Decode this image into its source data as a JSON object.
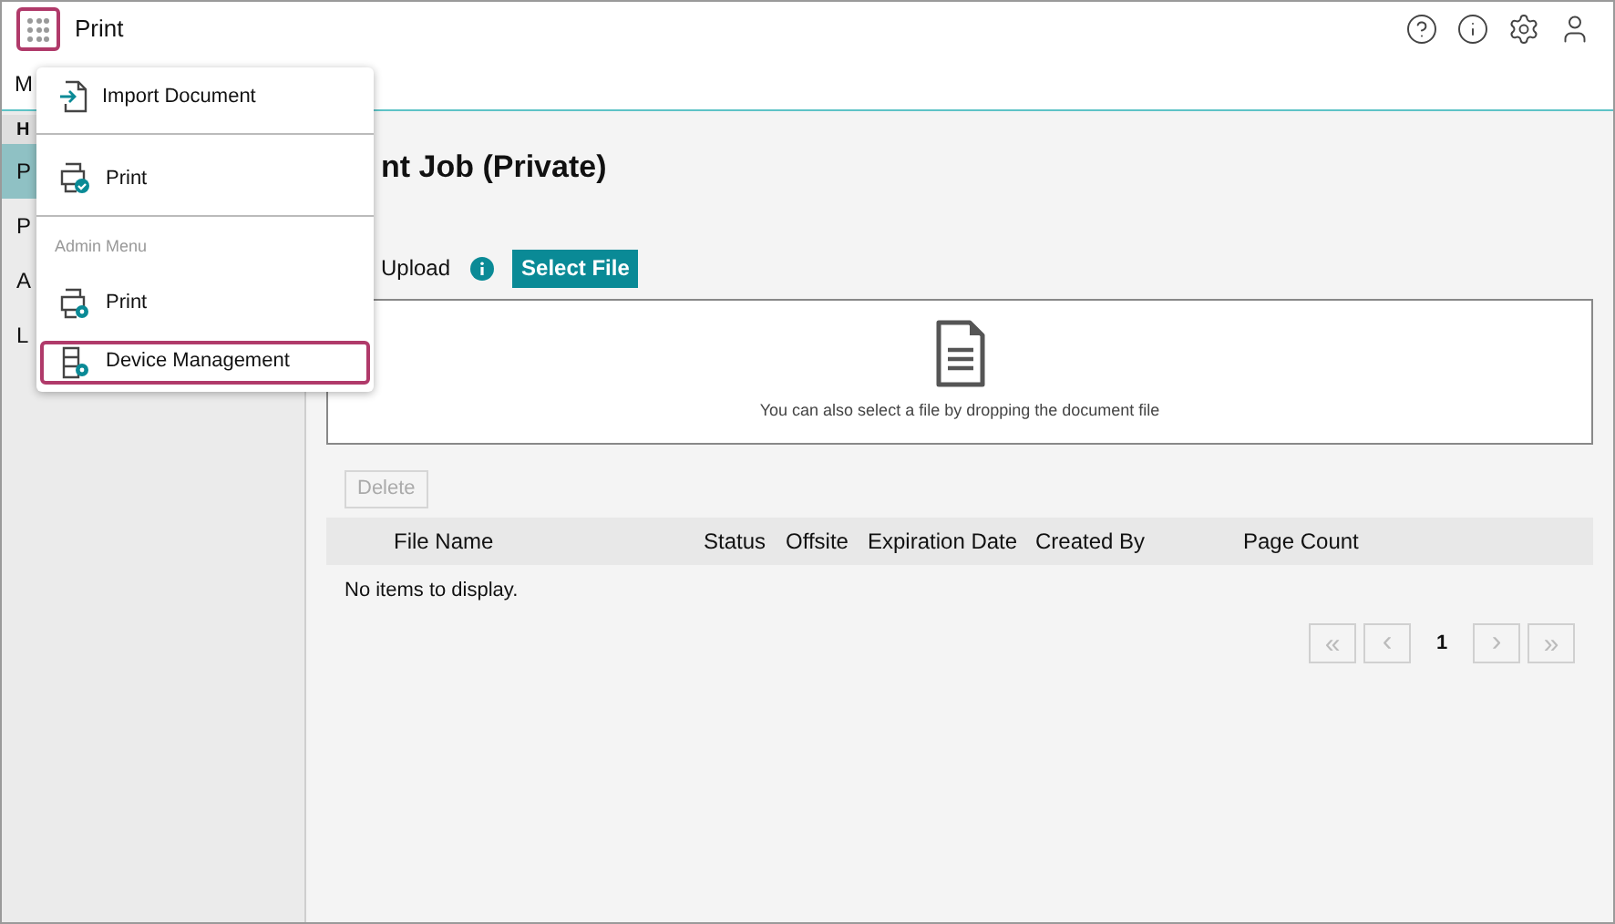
{
  "header": {
    "app_title": "Print"
  },
  "top_tab": {
    "label": "M"
  },
  "sidebar": {
    "items": [
      {
        "label": "H",
        "kind": "heading"
      },
      {
        "label": "P",
        "kind": "item",
        "selected": true
      },
      {
        "label": "P",
        "kind": "item",
        "selected": false
      },
      {
        "label": "A",
        "kind": "item",
        "selected": false
      },
      {
        "label": "L",
        "kind": "item",
        "selected": false
      }
    ]
  },
  "menu": {
    "sections": [
      {
        "items": [
          {
            "label": "Import Document",
            "selected": false
          }
        ]
      },
      {
        "items": [
          {
            "label": "Print",
            "selected": false
          }
        ]
      },
      {
        "heading": "Admin Menu",
        "items": [
          {
            "label": "Print",
            "selected": false
          },
          {
            "label": "Device Management",
            "selected": true
          }
        ]
      }
    ]
  },
  "page": {
    "title": "nt Job (Private)",
    "upload_label": "Upload",
    "select_button": "Select File",
    "drop_hint": "You can also select a file by dropping the document file",
    "delete_button": "Delete",
    "delete_disabled": true,
    "table": {
      "columns": [
        "File Name",
        "Status",
        "Offsite",
        "Expiration Date",
        "Created By",
        "Page Count"
      ],
      "empty_text": "No items to display."
    },
    "pagination": {
      "first": "«",
      "prev": "‹",
      "page": "1",
      "next": "›",
      "last": "»"
    }
  }
}
